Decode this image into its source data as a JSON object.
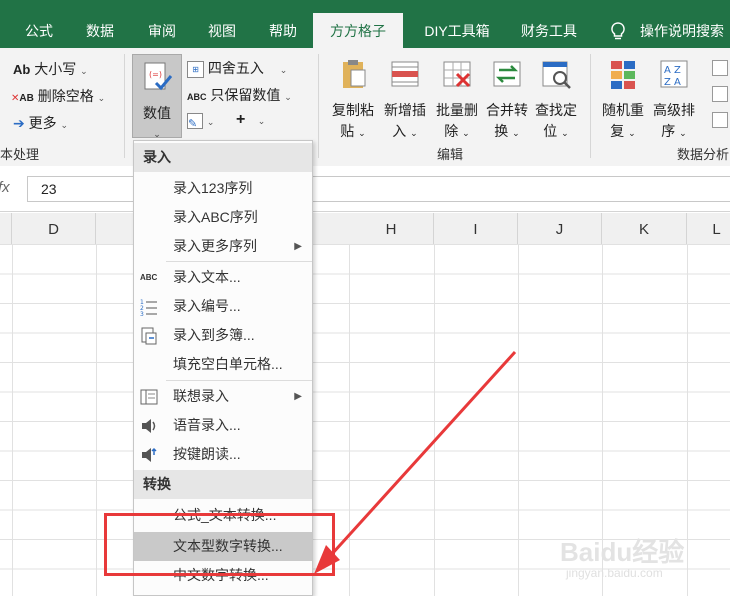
{
  "tabs": [
    {
      "label": "公式",
      "active": false
    },
    {
      "label": "数据",
      "active": false
    },
    {
      "label": "审阅",
      "active": false
    },
    {
      "label": "视图",
      "active": false
    },
    {
      "label": "帮助",
      "active": false
    },
    {
      "label": "方方格子",
      "active": true
    },
    {
      "label": "DIY工具箱",
      "active": false
    },
    {
      "label": "财务工具",
      "active": false
    }
  ],
  "search": {
    "label": "操作说明搜索"
  },
  "ribbon": {
    "text_group": {
      "items": [
        "大小写",
        "删除空格",
        "更多"
      ],
      "icon_texts": [
        "Ab",
        "AB"
      ],
      "label": "本处理"
    },
    "value_button": {
      "label": "数值"
    },
    "small_buttons": [
      "四舍五入",
      "只保留数值",
      "+"
    ],
    "abc_icon": "ABC",
    "edit_group": {
      "buttons": [
        {
          "line1": "复制粘",
          "line2": "贴"
        },
        {
          "line1": "新增插",
          "line2": "入"
        },
        {
          "line1": "批量删",
          "line2": "除"
        },
        {
          "line1": "合并转",
          "line2": "换"
        },
        {
          "line1": "查找定",
          "line2": "位"
        }
      ],
      "label": "编辑"
    },
    "analysis_group": {
      "buttons": [
        {
          "line1": "随机重",
          "line2": "复"
        },
        {
          "line1": "高级排",
          "line2": "序"
        }
      ],
      "label": "数据分析"
    }
  },
  "formula_bar": {
    "fx": "fx",
    "value": "23"
  },
  "columns": [
    "D",
    "H",
    "I",
    "J",
    "K",
    "L"
  ],
  "menu": {
    "sections": [
      {
        "title": "录入",
        "items": [
          {
            "label": "录入123序列",
            "icon": "",
            "submenu": false
          },
          {
            "label": "录入ABC序列",
            "icon": "",
            "submenu": false
          },
          {
            "label": "录入更多序列",
            "icon": "",
            "submenu": true
          },
          {
            "label": "录入文本...",
            "icon": "abc-icon",
            "submenu": false
          },
          {
            "label": "录入编号...",
            "icon": "numbered-list-icon",
            "submenu": false
          },
          {
            "label": "录入到多簿...",
            "icon": "multi-book-icon",
            "submenu": false
          },
          {
            "label": "填充空白单元格...",
            "icon": "",
            "submenu": false
          },
          {
            "label": "联想录入",
            "icon": "assoc-icon",
            "submenu": true
          },
          {
            "label": "语音录入...",
            "icon": "speaker-icon",
            "submenu": false
          },
          {
            "label": "按键朗读...",
            "icon": "speaker-key-icon",
            "submenu": false
          }
        ]
      },
      {
        "title": "转换",
        "items": [
          {
            "label": "公式_文本转换...",
            "icon": "",
            "submenu": false
          },
          {
            "label": "文本型数字转换...",
            "icon": "",
            "submenu": false,
            "highlighted": true
          },
          {
            "label": "中文数字转换...",
            "icon": "",
            "submenu": false
          }
        ]
      }
    ],
    "abc_icon_text": "ABC"
  },
  "watermark": {
    "brand": "Baidu经验",
    "url": "jingyan.baidu.com"
  },
  "colors": {
    "tab_bar": "#217346",
    "highlight": "#c9c9c9",
    "annotation": "#e8393a"
  }
}
